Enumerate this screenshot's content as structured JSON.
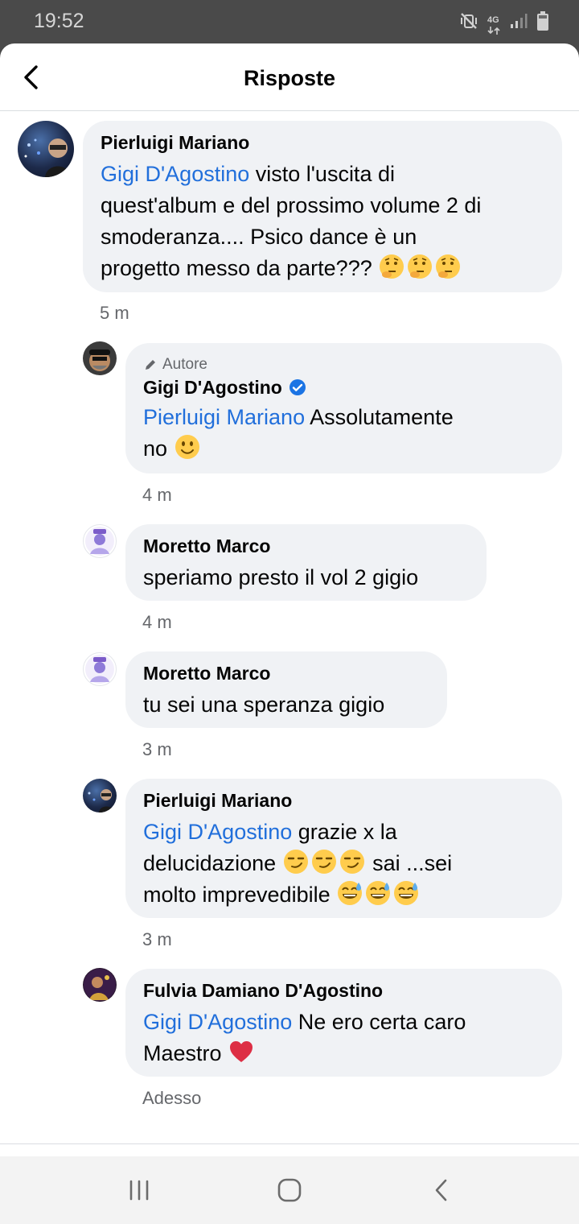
{
  "status_bar": {
    "time": "19:52",
    "network_label": "4G",
    "icons": [
      "mute-vibrate-icon",
      "network-4g-icon",
      "signal-icon",
      "battery-icon"
    ]
  },
  "header": {
    "title": "Risposte",
    "back_icon": "chevron-left-icon"
  },
  "colors": {
    "mention": "#216fdb",
    "bubble_bg": "#f0f2f5",
    "meta_text": "#65676b",
    "verified": "#1b74e4"
  },
  "comments": [
    {
      "author": "Pierluigi Mariano",
      "mention": "Gigi D'Agostino",
      "line1_rest": " visto l'uscita di",
      "line2": "quest'album e del prossimo volume 2  di",
      "line3": "smoderanza.... Psico dance è un",
      "line4": "progetto messo da parte???",
      "emojis": [
        "thinking-face",
        "thinking-face",
        "thinking-face"
      ],
      "time": "5 m"
    },
    {
      "badge": "Autore",
      "badge_icon": "pencil-icon",
      "author": "Gigi D'Agostino",
      "verified": true,
      "mention": "Pierluigi Mariano",
      "line1_rest": "  Assolutamente",
      "line2": "no",
      "emojis": [
        "slightly-smiling-face"
      ],
      "time": "4 m"
    },
    {
      "author": "Moretto Marco",
      "text": "speriamo presto il vol 2 gigio",
      "time": "4 m"
    },
    {
      "author": "Moretto Marco",
      "text": "tu sei una speranza gigio",
      "time": "3 m"
    },
    {
      "author": "Pierluigi Mariano",
      "mention": "Gigi D'Agostino",
      "line1_rest": " grazie x la",
      "line2a": "delucidazione",
      "line2b": " sai ...sei",
      "line3": "molto imprevedibile",
      "emojis_a": [
        "smirking-face",
        "smirking-face",
        "smirking-face"
      ],
      "emojis_b": [
        "grinning-sweat-face",
        "grinning-sweat-face",
        "grinning-sweat-face"
      ],
      "time": "3 m"
    },
    {
      "author": "Fulvia Damiano D'Agostino",
      "mention": "Gigi D'Agostino",
      "line1_rest": " Ne ero certa caro",
      "line2": "Maestro",
      "emojis": [
        "red-heart"
      ],
      "time": "Adesso"
    }
  ],
  "nav_bar": {
    "buttons": [
      "recent-apps-icon",
      "home-icon",
      "back-icon"
    ]
  }
}
